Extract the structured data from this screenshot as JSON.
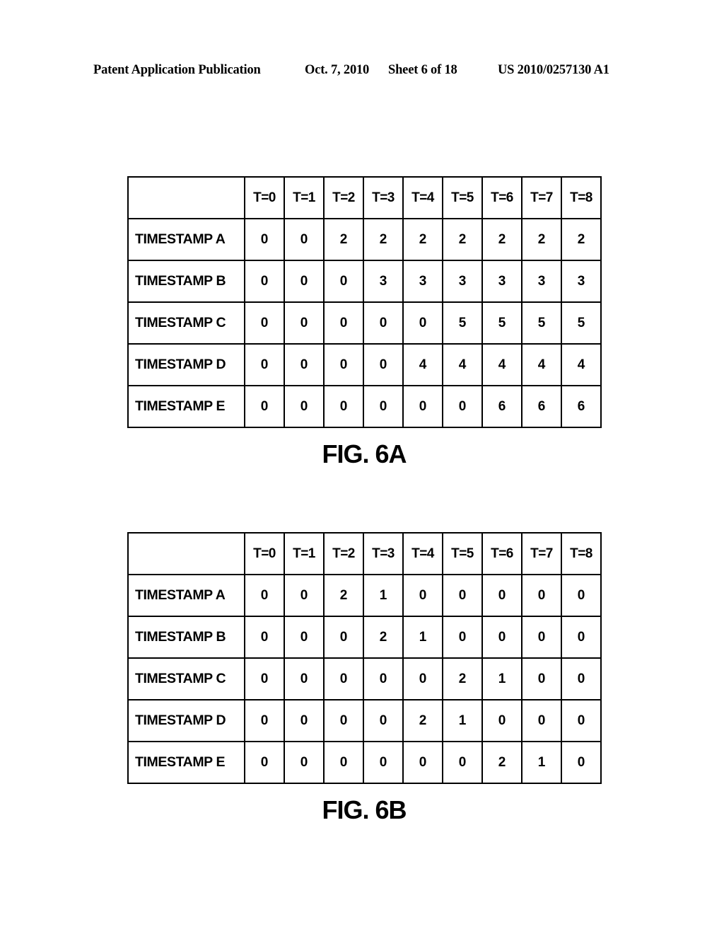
{
  "header": {
    "publication": "Patent Application Publication",
    "date": "Oct. 7, 2010",
    "sheet": "Sheet 6 of 18",
    "number": "US 2010/0257130 A1"
  },
  "figures": [
    {
      "caption": "FIG. 6A",
      "corner": "",
      "columns": [
        "T=0",
        "T=1",
        "T=2",
        "T=3",
        "T=4",
        "T=5",
        "T=6",
        "T=7",
        "T=8"
      ],
      "rows": [
        {
          "label": "TIMESTAMP A",
          "values": [
            "0",
            "0",
            "2",
            "2",
            "2",
            "2",
            "2",
            "2",
            "2"
          ]
        },
        {
          "label": "TIMESTAMP B",
          "values": [
            "0",
            "0",
            "0",
            "3",
            "3",
            "3",
            "3",
            "3",
            "3"
          ]
        },
        {
          "label": "TIMESTAMP C",
          "values": [
            "0",
            "0",
            "0",
            "0",
            "0",
            "5",
            "5",
            "5",
            "5"
          ]
        },
        {
          "label": "TIMESTAMP D",
          "values": [
            "0",
            "0",
            "0",
            "0",
            "4",
            "4",
            "4",
            "4",
            "4"
          ]
        },
        {
          "label": "TIMESTAMP E",
          "values": [
            "0",
            "0",
            "0",
            "0",
            "0",
            "0",
            "6",
            "6",
            "6"
          ]
        }
      ]
    },
    {
      "caption": "FIG. 6B",
      "corner": "",
      "columns": [
        "T=0",
        "T=1",
        "T=2",
        "T=3",
        "T=4",
        "T=5",
        "T=6",
        "T=7",
        "T=8"
      ],
      "rows": [
        {
          "label": "TIMESTAMP A",
          "values": [
            "0",
            "0",
            "2",
            "1",
            "0",
            "0",
            "0",
            "0",
            "0"
          ]
        },
        {
          "label": "TIMESTAMP B",
          "values": [
            "0",
            "0",
            "0",
            "2",
            "1",
            "0",
            "0",
            "0",
            "0"
          ]
        },
        {
          "label": "TIMESTAMP C",
          "values": [
            "0",
            "0",
            "0",
            "0",
            "0",
            "2",
            "1",
            "0",
            "0"
          ]
        },
        {
          "label": "TIMESTAMP D",
          "values": [
            "0",
            "0",
            "0",
            "0",
            "2",
            "1",
            "0",
            "0",
            "0"
          ]
        },
        {
          "label": "TIMESTAMP E",
          "values": [
            "0",
            "0",
            "0",
            "0",
            "0",
            "0",
            "2",
            "1",
            "0"
          ]
        }
      ]
    }
  ]
}
